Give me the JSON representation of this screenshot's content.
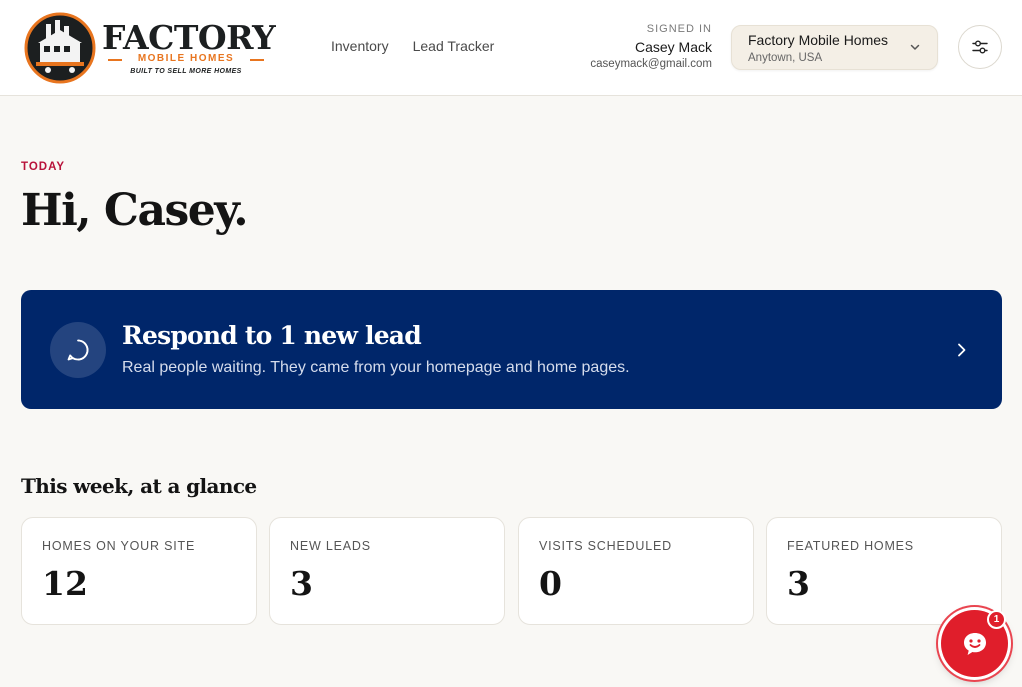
{
  "brand": {
    "name": "FACTORY",
    "subline": "MOBILE HOMES",
    "tagline": "BUILT TO SELL MORE HOMES",
    "accent_color": "#e8751f"
  },
  "nav": {
    "items": [
      {
        "label": "Inventory"
      },
      {
        "label": "Lead Tracker"
      }
    ]
  },
  "user": {
    "label": "SIGNED IN",
    "name": "Casey Mack",
    "email": "caseymack@gmail.com"
  },
  "store": {
    "name": "Factory Mobile Homes",
    "location": "Anytown, USA"
  },
  "icons": {
    "settings": "sliders-icon",
    "store_toggle": "chevron-down-icon",
    "lead": "chat-bubble-icon",
    "lead_arrow": "chevron-right-icon",
    "chat": "smiley-chat-icon"
  },
  "main": {
    "eyebrow": "TODAY",
    "greeting": "Hi, Casey.",
    "eyebrow_color": "#b8123a"
  },
  "lead_banner": {
    "title": "Respond to 1 new lead",
    "subtitle": "Real people waiting. They came from your homepage and home pages.",
    "bg_color": "#00266a"
  },
  "glance": {
    "title": "This week, at a glance",
    "stats": [
      {
        "label": "HOMES ON YOUR SITE",
        "value": "12"
      },
      {
        "label": "NEW LEADS",
        "value": "3"
      },
      {
        "label": "VISITS SCHEDULED",
        "value": "0"
      },
      {
        "label": "FEATURED HOMES",
        "value": "3"
      }
    ]
  },
  "chat": {
    "badge_count": "1",
    "color": "#e01e2b"
  }
}
